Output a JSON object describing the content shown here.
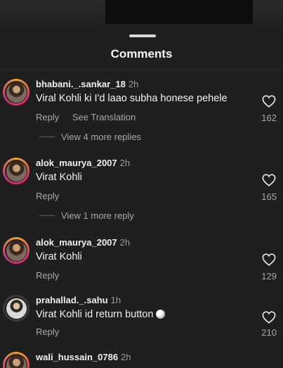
{
  "sheet": {
    "title": "Comments"
  },
  "comments": [
    {
      "username": "bhabani._.sankar_18",
      "time": "2h",
      "text": "Viral Kohli ki I'd laao subha honese pehele",
      "reply_label": "Reply",
      "translate_label": "See Translation",
      "likes": "162",
      "more_replies": "View 4 more replies"
    },
    {
      "username": "alok_maurya_2007",
      "time": "2h",
      "text": "Virat Kohli",
      "reply_label": "Reply",
      "likes": "165",
      "more_replies": "View 1 more reply"
    },
    {
      "username": "alok_maurya_2007",
      "time": "2h",
      "text": "Virat Kohli",
      "reply_label": "Reply",
      "likes": "129"
    },
    {
      "username": "prahallad._.sahu",
      "time": "1h",
      "text": "Virat Kohli id return button",
      "reply_label": "Reply",
      "likes": "210"
    },
    {
      "username": "wali_hussain_0786",
      "time": "2h"
    }
  ]
}
